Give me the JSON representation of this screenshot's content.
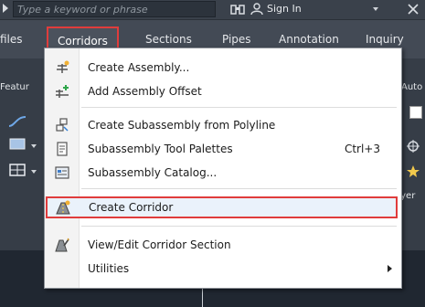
{
  "topbar": {
    "search_placeholder": "Type a keyword or phrase",
    "signin_label": "Sign In"
  },
  "tabs": [
    {
      "label": "files"
    },
    {
      "label": "Corridors",
      "active": true
    },
    {
      "label": "Sections"
    },
    {
      "label": "Pipes"
    },
    {
      "label": "Annotation"
    },
    {
      "label": "Inquiry"
    }
  ],
  "ribbon": {
    "left_label": "Featur",
    "right_label": "Auto",
    "right_label_2": "ayer"
  },
  "menu": {
    "items": [
      {
        "label": "Create Assembly...",
        "icon": "create-assembly-icon"
      },
      {
        "label": "Add Assembly Offset",
        "icon": "add-assembly-offset-icon"
      },
      {
        "label": "Create Subassembly from Polyline",
        "icon": "subassembly-polyline-icon"
      },
      {
        "label": "Subassembly Tool Palettes",
        "icon": "tool-palettes-icon",
        "shortcut": "Ctrl+3"
      },
      {
        "label": "Subassembly Catalog...",
        "icon": "catalog-icon"
      },
      {
        "label": "Create Corridor",
        "icon": "create-corridor-icon",
        "highlighted": true
      },
      {
        "label": "View/Edit Corridor Section",
        "icon": "corridor-section-icon"
      },
      {
        "label": "Utilities",
        "submenu": true
      }
    ]
  },
  "colors": {
    "highlight_border": "#e03c3c",
    "ribbon_bg": "#363d47",
    "menu_bg": "#ffffff"
  }
}
